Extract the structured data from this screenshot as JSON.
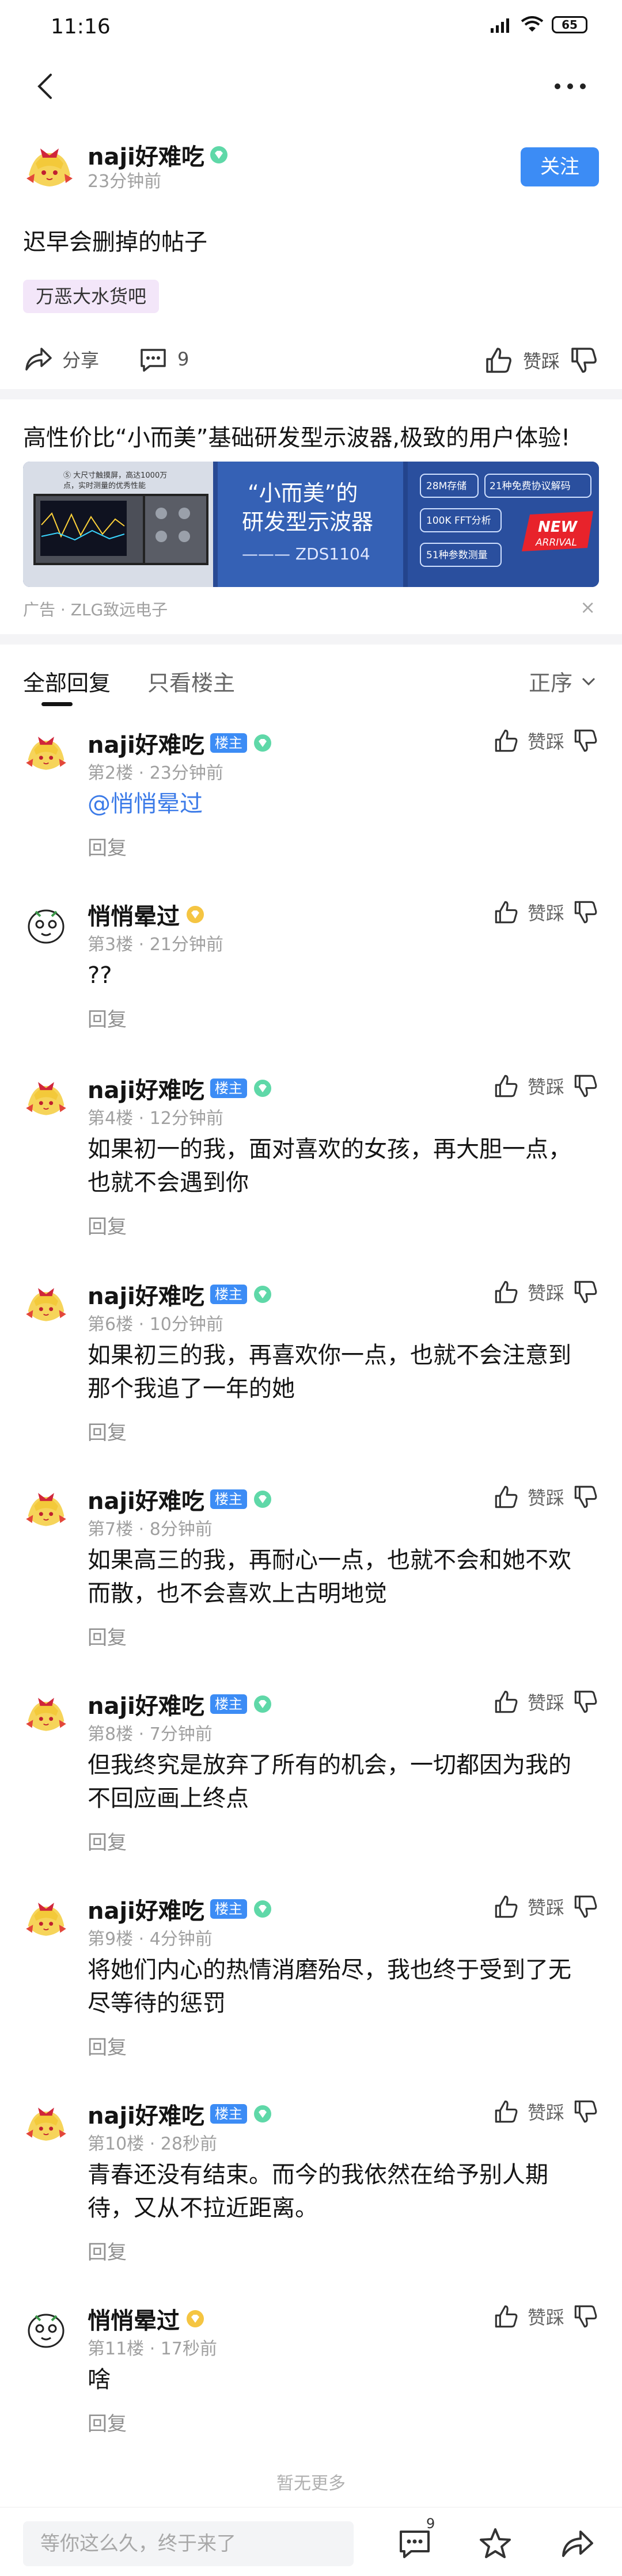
{
  "status_bar": {
    "time": "11:16",
    "battery": "65"
  },
  "post": {
    "author": "naji好难吃",
    "time": "23分钟前",
    "follow_label": "关注",
    "title": "迟早会删掉的帖子",
    "forum": "万恶大水货吧",
    "share_label": "分享",
    "comment_count": "9",
    "like_label": "赞踩"
  },
  "ad": {
    "title": "高性价比“小而美”基础研发型示波器,极致的用户体验!",
    "headline_line1": "“小而美”的",
    "headline_line2": "研发型示波器",
    "model": "——— ZDS1104",
    "features": [
      "28M存储",
      "21种免费协议解码",
      "100K FFT分析",
      "51种参数测量"
    ],
    "new_label": "NEW",
    "arrival_label": "ARRIVAL",
    "footer": "广告 · ZLG致远电子",
    "close": "×",
    "screen_caption1": "Ⓢ  大尺寸触摸屏，高达1000万",
    "screen_caption2": "     点，实时测量的优秀性能"
  },
  "tabs": {
    "all": "全部回复",
    "owner": "只看楼主",
    "sort": "正序"
  },
  "replies": [
    {
      "name": "naji好难吃",
      "owner": true,
      "vip": "green",
      "meta": "第2楼 · 23分钟前",
      "text": "@悄悄晕过",
      "link": true,
      "reply": "回复",
      "like": "赞踩"
    },
    {
      "name": "悄悄晕过",
      "owner": false,
      "vip": "gold",
      "meta": "第3楼 · 21分钟前",
      "text": "??",
      "link": false,
      "reply": "回复",
      "like": "赞踩"
    },
    {
      "name": "naji好难吃",
      "owner": true,
      "vip": "green",
      "meta": "第4楼 · 12分钟前",
      "text": "如果初一的我，面对喜欢的女孩，再大胆一点，也就不会遇到你",
      "link": false,
      "reply": "回复",
      "like": "赞踩"
    },
    {
      "name": "naji好难吃",
      "owner": true,
      "vip": "green",
      "meta": "第6楼 · 10分钟前",
      "text": "如果初三的我，再喜欢你一点，也就不会注意到那个我追了一年的她",
      "link": false,
      "reply": "回复",
      "like": "赞踩"
    },
    {
      "name": "naji好难吃",
      "owner": true,
      "vip": "green",
      "meta": "第7楼 · 8分钟前",
      "text": "如果高三的我，再耐心一点，也就不会和她不欢而散，也不会喜欢上古明地觉",
      "link": false,
      "reply": "回复",
      "like": "赞踩"
    },
    {
      "name": "naji好难吃",
      "owner": true,
      "vip": "green",
      "meta": "第8楼 · 7分钟前",
      "text": "但我终究是放弃了所有的机会，一切都因为我的不回应画上终点",
      "link": false,
      "reply": "回复",
      "like": "赞踩"
    },
    {
      "name": "naji好难吃",
      "owner": true,
      "vip": "green",
      "meta": "第9楼 · 4分钟前",
      "text": "将她们内心的热情消磨殆尽，我也终于受到了无尽等待的惩罚",
      "link": false,
      "reply": "回复",
      "like": "赞踩"
    },
    {
      "name": "naji好难吃",
      "owner": true,
      "vip": "green",
      "meta": "第10楼 · 28秒前",
      "text": "青春还没有结束。而今的我依然在给予别人期待，又从不拉近距离。",
      "link": false,
      "reply": "回复",
      "like": "赞踩"
    },
    {
      "name": "悄悄晕过",
      "owner": false,
      "vip": "gold",
      "meta": "第11楼 · 17秒前",
      "text": "啥",
      "link": false,
      "reply": "回复",
      "like": "赞踩"
    }
  ],
  "owner_badge": "楼主",
  "no_more": "暂无更多",
  "bottom": {
    "placeholder": "等你这么久，终于来了",
    "comment_count": "9"
  }
}
